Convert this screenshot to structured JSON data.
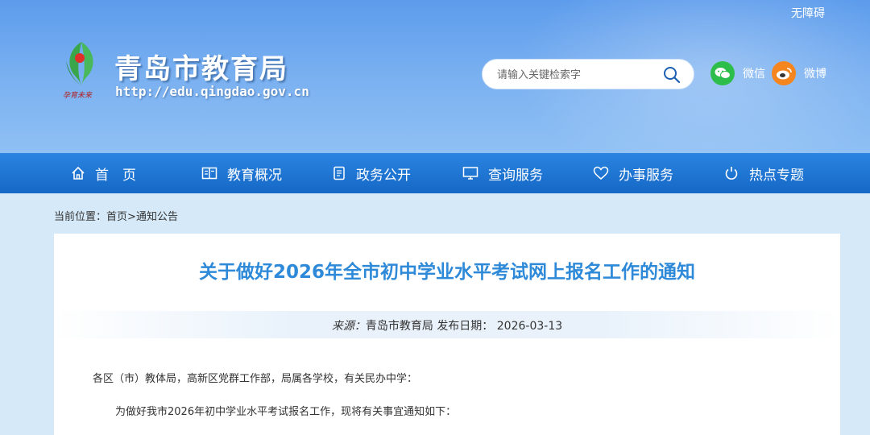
{
  "header": {
    "accessibility": "无障碍",
    "logo_text": "孕育未来",
    "site_title": "青岛市教育局",
    "site_url": "http://edu.qingdao.gov.cn",
    "search_placeholder": "请输入关键检索字",
    "wechat_label": "微信",
    "weibo_label": "微博"
  },
  "nav": {
    "items": [
      {
        "label": "首　页",
        "icon": "home-icon"
      },
      {
        "label": "教育概况",
        "icon": "book-icon"
      },
      {
        "label": "政务公开",
        "icon": "document-icon"
      },
      {
        "label": "查询服务",
        "icon": "monitor-icon"
      },
      {
        "label": "办事服务",
        "icon": "heart-icon"
      },
      {
        "label": "热点专题",
        "icon": "power-icon"
      }
    ]
  },
  "breadcrumb": {
    "prefix": "当前位置：",
    "home": "首页",
    "sep": ">",
    "current": "通知公告"
  },
  "article": {
    "title": "关于做好2026年全市初中学业水平考试网上报名工作的通知",
    "source_label": "来源：",
    "source": "青岛市教育局",
    "date_label": "发布日期：",
    "date": "2026-03-13",
    "para1": "各区（市）教体局，高新区党群工作部，局属各学校，有关民办中学：",
    "para2": "为做好我市2026年初中学业水平考试报名工作，现将有关事宜通知如下："
  },
  "colors": {
    "header_top": "#5d9cec",
    "nav": "#1a6fcb",
    "title": "#2e8ad8",
    "wechat": "#2dbd4a",
    "weibo": "#f5851f"
  }
}
